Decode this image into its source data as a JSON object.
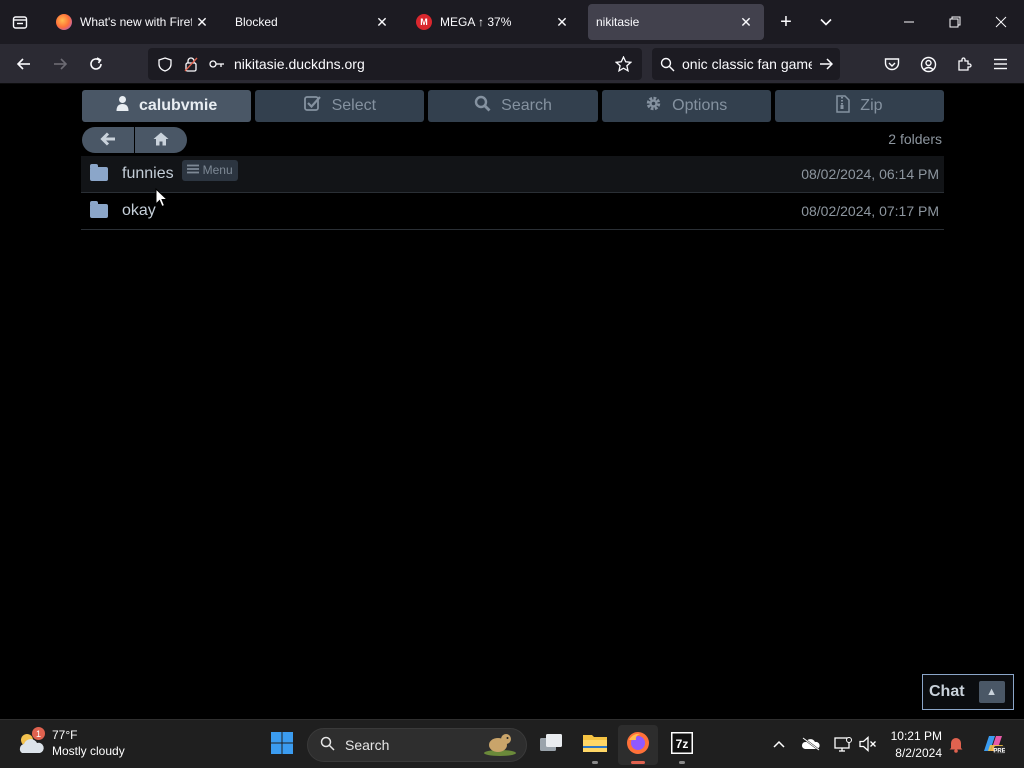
{
  "browser": {
    "tabs": [
      {
        "title": "What's new with Firefox",
        "favicon": "firefox-icon",
        "active": false
      },
      {
        "title": "Blocked",
        "favicon": "",
        "active": false
      },
      {
        "title": "MEGA ↑ 37%",
        "favicon": "mega-icon",
        "active": false
      },
      {
        "title": "nikitasie",
        "favicon": "",
        "active": true
      }
    ],
    "url": "nikitasie.duckdns.org",
    "search_text": "onic classic fan game",
    "colors": {
      "tabbar": "#1c1b22",
      "navbar": "#2b2a33",
      "active_tab": "#42414d"
    }
  },
  "page": {
    "toolbar": [
      {
        "label": "calubvmie",
        "icon": "user-icon"
      },
      {
        "label": "Select",
        "icon": "checkbox-icon"
      },
      {
        "label": "Search",
        "icon": "search-icon"
      },
      {
        "label": "Options",
        "icon": "gear-icon"
      },
      {
        "label": "Zip",
        "icon": "zip-file-icon"
      }
    ],
    "folder_count": "2 folders",
    "folders": [
      {
        "name": "funnies",
        "menu_label": "Menu",
        "date": "08/02/2024, 06:14 PM"
      },
      {
        "name": "okay",
        "date": "08/02/2024, 07:17 PM"
      }
    ],
    "chat": {
      "label": "Chat"
    }
  },
  "taskbar": {
    "weather": {
      "temp": "77°F",
      "condition": "Mostly cloudy",
      "badge": "1"
    },
    "search_label": "Search",
    "time": "10:21 PM",
    "date": "8/2/2024",
    "apps": [
      "start-icon",
      "task-view-icon",
      "file-explorer-icon",
      "firefox-icon",
      "7zip-icon"
    ]
  }
}
